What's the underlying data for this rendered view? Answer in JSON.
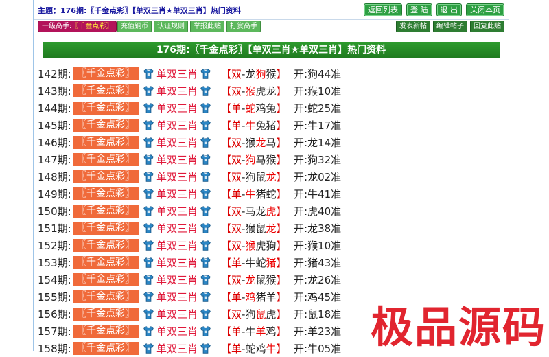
{
  "header": {
    "topic": "主题：176期:〖千金点彩〗【单双三肖★单双三肖】热门资料",
    "buttons": [
      "返回列表",
      "登 陆",
      "退 出",
      "关闭本页"
    ]
  },
  "toolbar": {
    "level_label": "一级高手:",
    "level_value": "〖千金点彩〗",
    "left_buttons": [
      "充值铜币",
      "认证规则",
      "举报此贴",
      "打赏高手"
    ],
    "right_buttons": [
      "发表新帖",
      "编辑帖子",
      "回复此贴"
    ]
  },
  "post_title": "176期:〖千金点彩〗【单双三肖★单双三肖】热门资料",
  "rows": [
    {
      "period": "142期:",
      "tag": "〖千金点彩〗",
      "label": "单双三肖",
      "grp": "双",
      "zodiacs": [
        "龙",
        "狗",
        "猴"
      ],
      "hit": 1,
      "result": "开:狗44准"
    },
    {
      "period": "143期:",
      "tag": "〖千金点彩〗",
      "label": "单双三肖",
      "grp": "双",
      "zodiacs": [
        "猴",
        "虎",
        "龙"
      ],
      "hit": 0,
      "result": "开:猴10准"
    },
    {
      "period": "144期:",
      "tag": "〖千金点彩〗",
      "label": "单双三肖",
      "grp": "单",
      "zodiacs": [
        "蛇",
        "鸡",
        "兔"
      ],
      "hit": 0,
      "result": "开:蛇25准"
    },
    {
      "period": "145期:",
      "tag": "〖千金点彩〗",
      "label": "单双三肖",
      "grp": "单",
      "zodiacs": [
        "牛",
        "兔",
        "猪"
      ],
      "hit": 0,
      "result": "开:牛17准"
    },
    {
      "period": "146期:",
      "tag": "〖千金点彩〗",
      "label": "单双三肖",
      "grp": "双",
      "zodiacs": [
        "猴",
        "龙",
        "马"
      ],
      "hit": 1,
      "result": "开:龙14准"
    },
    {
      "period": "147期:",
      "tag": "〖千金点彩〗",
      "label": "单双三肖",
      "grp": "双",
      "zodiacs": [
        "狗",
        "马",
        "猴"
      ],
      "hit": 0,
      "result": "开:狗32准"
    },
    {
      "period": "148期:",
      "tag": "〖千金点彩〗",
      "label": "单双三肖",
      "grp": "双",
      "zodiacs": [
        "狗",
        "鼠",
        "龙"
      ],
      "hit": 2,
      "result": "开:龙02准"
    },
    {
      "period": "149期:",
      "tag": "〖千金点彩〗",
      "label": "单双三肖",
      "grp": "单",
      "zodiacs": [
        "牛",
        "猪",
        "蛇"
      ],
      "hit": 0,
      "result": "开:牛41准"
    },
    {
      "period": "150期:",
      "tag": "〖千金点彩〗",
      "label": "单双三肖",
      "grp": "双",
      "zodiacs": [
        "马",
        "龙",
        "虎"
      ],
      "hit": 2,
      "result": "开:虎40准"
    },
    {
      "period": "151期:",
      "tag": "〖千金点彩〗",
      "label": "单双三肖",
      "grp": "双",
      "zodiacs": [
        "猴",
        "鼠",
        "龙"
      ],
      "hit": 2,
      "result": "开:龙38准"
    },
    {
      "period": "152期:",
      "tag": "〖千金点彩〗",
      "label": "单双三肖",
      "grp": "双",
      "zodiacs": [
        "猴",
        "虎",
        "狗"
      ],
      "hit": 0,
      "result": "开:猴10准"
    },
    {
      "period": "153期:",
      "tag": "〖千金点彩〗",
      "label": "单双三肖",
      "grp": "单",
      "zodiacs": [
        "牛",
        "蛇",
        "猪"
      ],
      "hit": 2,
      "result": "开:猪43准"
    },
    {
      "period": "154期:",
      "tag": "〖千金点彩〗",
      "label": "单双三肖",
      "grp": "双",
      "zodiacs": [
        "龙",
        "鼠",
        "猴"
      ],
      "hit": 0,
      "result": "开:龙26准"
    },
    {
      "period": "155期:",
      "tag": "〖千金点彩〗",
      "label": "单双三肖",
      "grp": "单",
      "zodiacs": [
        "鸡",
        "猪",
        "羊"
      ],
      "hit": 0,
      "result": "开:鸡45准"
    },
    {
      "period": "156期:",
      "tag": "〖千金点彩〗",
      "label": "单双三肖",
      "grp": "双",
      "zodiacs": [
        "狗",
        "鼠",
        "虎"
      ],
      "hit": 1,
      "result": "开:鼠18准"
    },
    {
      "period": "157期:",
      "tag": "〖千金点彩〗",
      "label": "单双三肖",
      "grp": "单",
      "zodiacs": [
        "牛",
        "羊",
        "鸡"
      ],
      "hit": 1,
      "result": "开:羊23准"
    },
    {
      "period": "158期:",
      "tag": "〖千金点彩〗",
      "label": "单双三肖",
      "grp": "单",
      "zodiacs": [
        "蛇",
        "鸡",
        "牛"
      ],
      "hit": 2,
      "result": "开:牛05准"
    }
  ],
  "watermark": "极品源码",
  "colors": {
    "accent_green": "#2ea043",
    "tag_orange": "#f06a3a",
    "hit_red": "#e00000",
    "level_magenta": "#b3135a"
  }
}
